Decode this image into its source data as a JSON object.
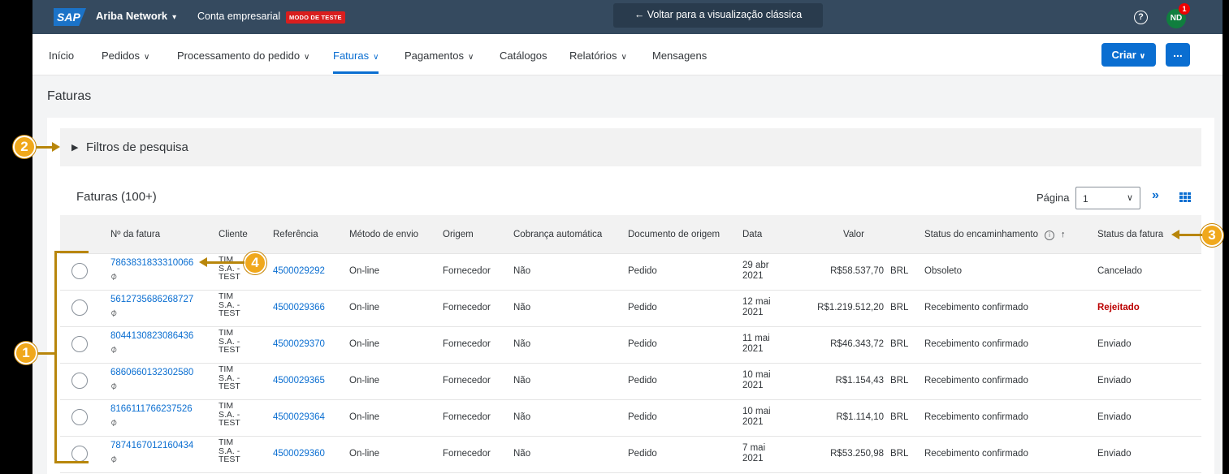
{
  "shell": {
    "logo": "SAP",
    "product": "Ariba Network",
    "account": "Conta empresarial",
    "test_badge": "MODO DE TESTE",
    "classic_view": "← Voltar para a visualização clássica",
    "help": "?",
    "avatar": "ND",
    "notifications": "1"
  },
  "nav": {
    "tabs": [
      {
        "label": "Início",
        "chevron": false
      },
      {
        "label": "Pedidos",
        "chevron": true
      },
      {
        "label": "Processamento do pedido",
        "chevron": true
      },
      {
        "label": "Faturas",
        "chevron": true,
        "active": true
      },
      {
        "label": "Pagamentos",
        "chevron": true
      },
      {
        "label": "Catálogos",
        "chevron": false
      },
      {
        "label": "Relatórios",
        "chevron": true
      },
      {
        "label": "Mensagens",
        "chevron": false
      }
    ],
    "create_label": "Criar",
    "more_label": "..."
  },
  "page_title": "Faturas",
  "filters": {
    "label": "Filtros de pesquisa"
  },
  "table": {
    "title": "Faturas (100+)",
    "page_label": "Página",
    "page_value": "1",
    "headers": {
      "invoice_no": "Nº da fatura",
      "client": "Cliente",
      "reference": "Referência",
      "send_method": "Método de envio",
      "origin": "Origem",
      "auto_billing": "Cobrança automática",
      "source_doc": "Documento de origem",
      "date": "Data",
      "value": "Valor",
      "routing_status": "Status do encaminhamento",
      "invoice_status": "Status da fatura"
    },
    "rows": [
      {
        "invoice": "7863831833310066",
        "client": [
          "TIM",
          "S.A. -",
          "TEST"
        ],
        "reference": "4500029292",
        "method": "On-line",
        "origin": "Fornecedor",
        "auto": "Não",
        "doc": "Pedido",
        "date": [
          "29 abr",
          "2021"
        ],
        "value": "R$58.537,70",
        "currency": "BRL",
        "routing": "Obsoleto",
        "status": "Cancelado",
        "status_type": "normal"
      },
      {
        "invoice": "5612735686268727",
        "client": [
          "TIM",
          "S.A. -",
          "TEST"
        ],
        "reference": "4500029366",
        "method": "On-line",
        "origin": "Fornecedor",
        "auto": "Não",
        "doc": "Pedido",
        "date": [
          "12 mai",
          "2021"
        ],
        "value": "R$1.219.512,20",
        "currency": "BRL",
        "routing": "Recebimento confirmado",
        "status": "Rejeitado",
        "status_type": "rejected"
      },
      {
        "invoice": "8044130823086436",
        "client": [
          "TIM",
          "S.A. -",
          "TEST"
        ],
        "reference": "4500029370",
        "method": "On-line",
        "origin": "Fornecedor",
        "auto": "Não",
        "doc": "Pedido",
        "date": [
          "11 mai",
          "2021"
        ],
        "value": "R$46.343,72",
        "currency": "BRL",
        "routing": "Recebimento confirmado",
        "status": "Enviado",
        "status_type": "normal"
      },
      {
        "invoice": "6860660132302580",
        "client": [
          "TIM",
          "S.A. -",
          "TEST"
        ],
        "reference": "4500029365",
        "method": "On-line",
        "origin": "Fornecedor",
        "auto": "Não",
        "doc": "Pedido",
        "date": [
          "10 mai",
          "2021"
        ],
        "value": "R$1.154,43",
        "currency": "BRL",
        "routing": "Recebimento confirmado",
        "status": "Enviado",
        "status_type": "normal"
      },
      {
        "invoice": "8166111766237526",
        "client": [
          "TIM",
          "S.A. -",
          "TEST"
        ],
        "reference": "4500029364",
        "method": "On-line",
        "origin": "Fornecedor",
        "auto": "Não",
        "doc": "Pedido",
        "date": [
          "10 mai",
          "2021"
        ],
        "value": "R$1.114,10",
        "currency": "BRL",
        "routing": "Recebimento confirmado",
        "status": "Enviado",
        "status_type": "normal"
      },
      {
        "invoice": "7874167012160434",
        "client": [
          "TIM",
          "S.A. -",
          "TEST"
        ],
        "reference": "4500029360",
        "method": "On-line",
        "origin": "Fornecedor",
        "auto": "Não",
        "doc": "Pedido",
        "date": [
          "7 mai",
          "2021"
        ],
        "value": "R$53.250,98",
        "currency": "BRL",
        "routing": "Recebimento confirmado",
        "status": "Enviado",
        "status_type": "normal"
      }
    ]
  },
  "annotations": [
    "1",
    "2",
    "3",
    "4"
  ],
  "colors": {
    "shell_bg": "#354a5f",
    "accent": "#0a6ed1",
    "test_badge": "#d91e1e",
    "rejected": "#bb0000",
    "annotation": "#f0a81c"
  }
}
